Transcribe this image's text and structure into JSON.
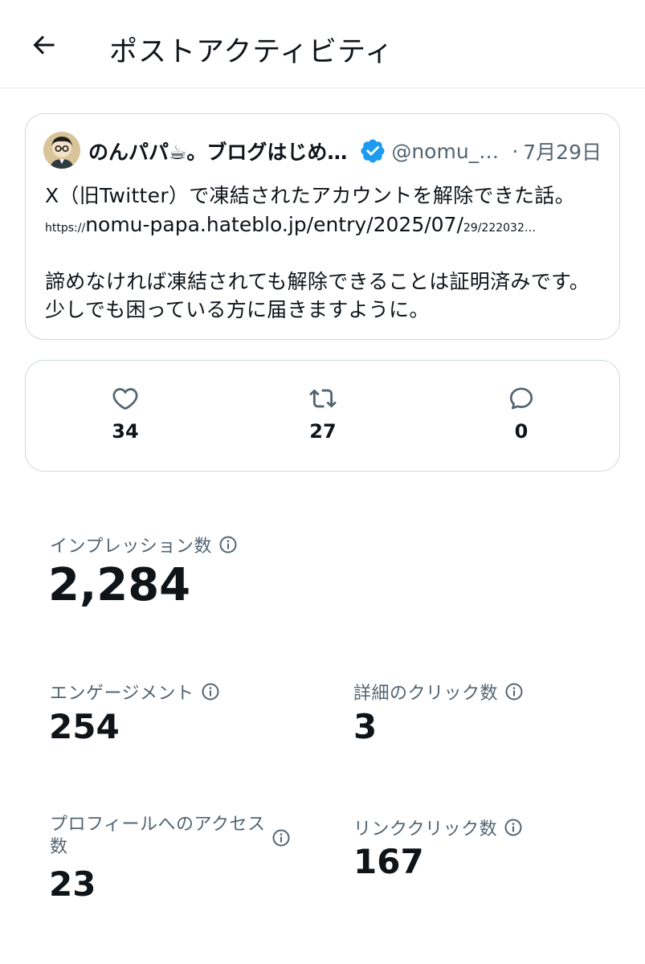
{
  "header": {
    "title": "ポストアクティビティ"
  },
  "post": {
    "author_name": "のんパパ☕。ブログはじめました",
    "handle": "@nomu_papa",
    "separator": "·",
    "date": "7月29日",
    "line1": "X（旧Twitter）で凍結されたアカウントを解除できた話。",
    "link_scheme": "https://",
    "link_main": "nomu-papa.hateblo.jp/entry/2025/07/",
    "link_tail": "29/222032…",
    "line3": "諦めなければ凍結されても解除できることは証明済みです。",
    "line4": "少しでも困っている方に届きますように。"
  },
  "engagement_bar": {
    "likes": "34",
    "reposts": "27",
    "replies": "0"
  },
  "stats": {
    "impressions_label": "インプレッション数",
    "impressions_value": "2,284",
    "engagements_label": "エンゲージメント",
    "engagements_value": "254",
    "detail_clicks_label": "詳細のクリック数",
    "detail_clicks_value": "3",
    "profile_visits_label": "プロフィールへのアクセス数",
    "profile_visits_value": "23",
    "link_clicks_label": "リンククリック数",
    "link_clicks_value": "167"
  },
  "icons": {
    "back": "arrow-left-icon",
    "verified": "verified-badge-icon",
    "like": "heart-icon",
    "repost": "repost-icon",
    "reply": "reply-bubble-icon",
    "info": "info-circle-icon"
  },
  "colors": {
    "text_primary": "#0f1419",
    "text_secondary": "#536471",
    "border": "#cfd9de",
    "verified_blue": "#1d9bf0"
  }
}
